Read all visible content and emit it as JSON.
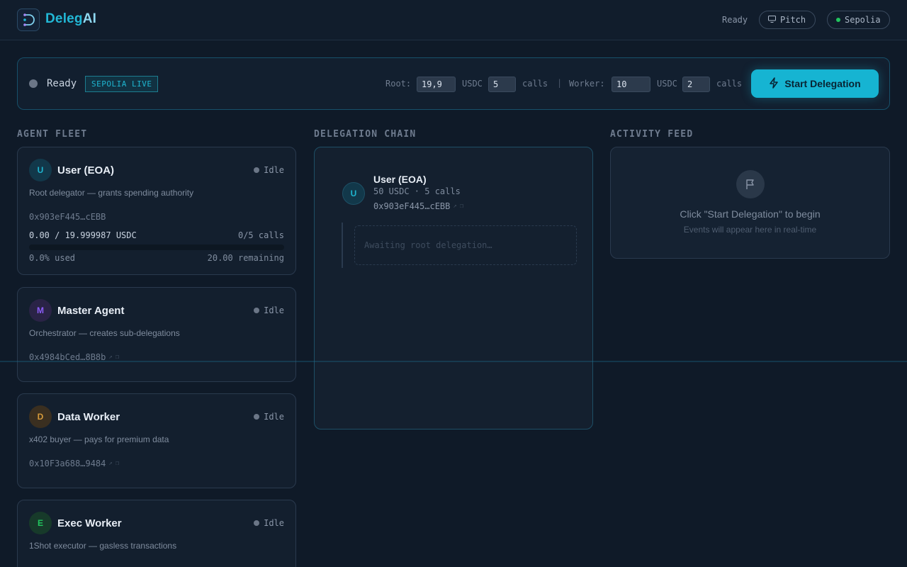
{
  "header": {
    "logo_main": "Deleg",
    "logo_ai": "AI",
    "status": "Ready",
    "pitch_label": "Pitch",
    "network_label": "Sepolia"
  },
  "control": {
    "status": "Ready",
    "badge": "SEPOLIA LIVE",
    "root_label": "Root:",
    "root_amount": "19,9",
    "root_unit": "USDC",
    "root_calls": "5",
    "calls_label": "calls",
    "separator": "|",
    "worker_label": "Worker:",
    "worker_amount": "10",
    "worker_unit": "USDC",
    "worker_calls": "2",
    "start_label": "Start Delegation"
  },
  "sections": {
    "fleet": "AGENT FLEET",
    "chain": "DELEGATION CHAIN",
    "feed": "ACTIVITY FEED"
  },
  "agents": [
    {
      "initial": "U",
      "name": "User (EOA)",
      "status": "Idle",
      "desc": "Root delegator — grants spending authority",
      "address": "0x903eF445…cEBB",
      "budget": "0.00 / 19.999987 USDC",
      "calls": "0/5 calls",
      "used_fraction": 0,
      "used": "0.0% used",
      "remaining": "20.00 remaining"
    },
    {
      "initial": "M",
      "name": "Master Agent",
      "status": "Idle",
      "desc": "Orchestrator — creates sub-delegations",
      "address": "0x4984bCed…8B8b"
    },
    {
      "initial": "D",
      "name": "Data Worker",
      "status": "Idle",
      "desc": "x402 buyer — pays for premium data",
      "address": "0x10F3a688…9484"
    },
    {
      "initial": "E",
      "name": "Exec Worker",
      "status": "Idle",
      "desc": "1Shot executor — gasless transactions"
    }
  ],
  "chain": {
    "initial": "U",
    "name": "User (EOA)",
    "meta": "50 USDC · 5 calls",
    "address": "0x903eF445…cEBB",
    "awaiting": "Awaiting root delegation…"
  },
  "feed": {
    "main": "Click \"Start Delegation\" to begin",
    "sub": "Events will appear here in real-time"
  },
  "colors": {
    "accent": "#16b4d2",
    "master": "#8b5cf6",
    "data_worker": "#d59a3a",
    "exec_worker": "#22c55e"
  }
}
